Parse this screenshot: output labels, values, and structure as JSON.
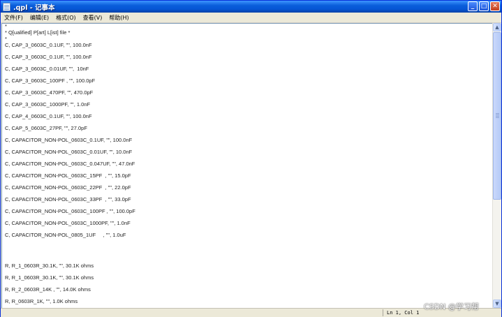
{
  "window": {
    "title": ".qpl - 记事本",
    "buttons": {
      "minimize": "_",
      "maximize": "□",
      "close": "✕"
    }
  },
  "menu": [
    {
      "label": "文件(F)"
    },
    {
      "label": "编辑(E)"
    },
    {
      "label": "格式(O)"
    },
    {
      "label": "查看(V)"
    },
    {
      "label": "帮助(H)"
    }
  ],
  "editor": {
    "lines": [
      {
        "text": "*"
      },
      {
        "text": "* Q[ualified] P[art] L[ist] file *"
      },
      {
        "text": "*"
      },
      {
        "text": "C, CAP_3_0603C_0.1UF, \"\", 100.0nF"
      },
      {
        "text": "C, CAP_3_0603C_0.1UF, \"\", 100.0nF"
      },
      {
        "text": "C, CAP_3_0603C_0.01UF, \"\",  10nF"
      },
      {
        "text": "C, CAP_3_0603C_100PF , \"\", 100.0pF"
      },
      {
        "text": "C, CAP_3_0603C_470PF, \"\", 470.0pF"
      },
      {
        "text": "C, CAP_3_0603C_1000PF, \"\", 1.0nF"
      },
      {
        "text": "C, CAP_4_0603C_0.1UF, \"\", 100.0nF"
      },
      {
        "text": "C, CAP_5_0603C_27PF, \"\", 27.0pF"
      },
      {
        "text": "C, CAPACITOR_NON-POL_0603C_0.1UF, \"\", 100.0nF"
      },
      {
        "text": "C, CAPACITOR_NON-POL_0603C_0.01UF, \"\", 10.0nF"
      },
      {
        "text": "C, CAPACITOR_NON-POL_0603C_0.047UF, \"\", 47.0nF"
      },
      {
        "text": "C, CAPACITOR_NON-POL_0603C_15PF  , \"\", 15.0pF"
      },
      {
        "text": "C, CAPACITOR_NON-POL_0603C_22PF  , \"\", 22.0pF"
      },
      {
        "text": "C, CAPACITOR_NON-POL_0603C_33PF  , \"\", 33.0pF"
      },
      {
        "text": "C, CAPACITOR_NON-POL_0603C_100PF , \"\", 100.0pF"
      },
      {
        "text": "C, CAPACITOR_NON-POL_0603C_1000PF, \"\", 1.0nF"
      },
      {
        "text": "C, CAPACITOR_NON-POL_0805_1UF     , \"\", 1.0uF"
      },
      {
        "text": "R, R_1_0603R_30.1K, \"\", 30.1K ohms"
      },
      {
        "text": "R, R_1_0603R_30.1K, \"\", 30.1K ohms"
      },
      {
        "text": "R, R_2_0603R_14K , \"\", 14.0K ohms"
      },
      {
        "text": "R, R_0603R_1K, \"\", 1.0K ohms"
      }
    ]
  },
  "status": {
    "position": "Ln 1, Col 1"
  },
  "watermark": "CSDN @学习帮",
  "colors": {
    "titlebar": "#0A5EDB",
    "chrome": "#ECE9D8",
    "text": "#222222"
  }
}
